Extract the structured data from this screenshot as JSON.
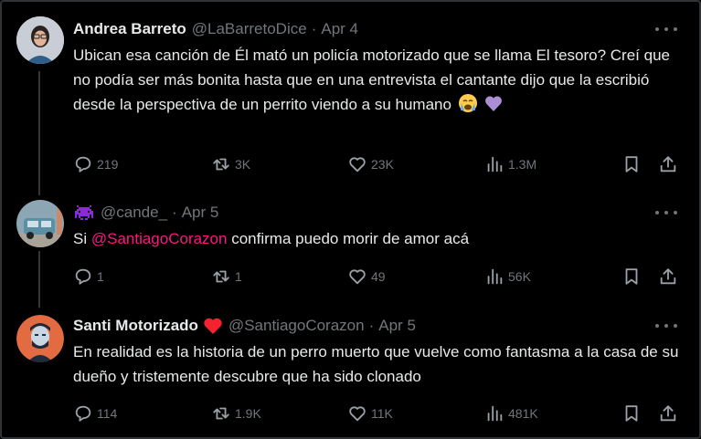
{
  "tweets": [
    {
      "name": "Andrea Barreto",
      "handle": "@LaBarretoDice",
      "date": "Apr 4",
      "text": "Ubican esa canción de Él mató un policía motorizado que se llama El tesoro? Creí que no podía ser más bonita hasta que en una entrevista el cantante dijo que la escribió desde la perspectiva de un perrito viendo a su humano",
      "emojis": [
        "crying-face",
        "purple-heart"
      ],
      "replies": "219",
      "reposts": "3K",
      "likes": "23K",
      "views": "1.3M"
    },
    {
      "handle": "@cande_",
      "date": "Apr 5",
      "text_before": "Si ",
      "mention": "@SantiagoCorazon",
      "text_after": " confirma puedo morir de amor acá",
      "name_icon": "space-invader-emoji",
      "replies": "1",
      "reposts": "1",
      "likes": "49",
      "views": "56K"
    },
    {
      "name": "Santi Motorizado",
      "name_icon": "red-heart-emoji",
      "handle": "@SantiagoCorazon",
      "date": "Apr 5",
      "text": "En realidad es la historia de un perro muerto que vuelve como fantasma a la casa de su dueño y tristemente descubre que ha sido clonado",
      "replies": "114",
      "reposts": "1.9K",
      "likes": "11K",
      "views": "481K"
    }
  ],
  "colors": {
    "background": "#000000",
    "text": "#e7e9ea",
    "secondary": "#71767b",
    "mention": "#f91880",
    "heart": "#f4212e"
  }
}
